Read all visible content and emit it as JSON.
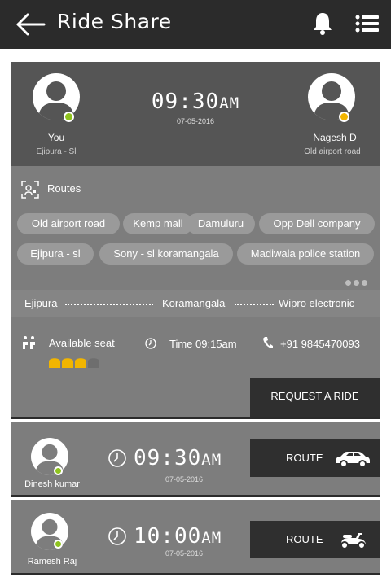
{
  "header": {
    "title": "Ride Share",
    "back_icon": "back-arrow-icon",
    "notification_icon": "bell-icon",
    "menu_icon": "list-menu-icon"
  },
  "ride_card": {
    "driver": {
      "name": "You",
      "location": "Ejipura - Sl",
      "status_color": "#8fc31f"
    },
    "passenger": {
      "name": "Nagesh D",
      "location": "Old airport road",
      "status_color": "#f2b500"
    },
    "time": "09:30",
    "ampm": "AM",
    "date": "07-05-2016",
    "routes_label": "Routes",
    "routes": [
      "Old airport road",
      "Kemp mall",
      "Damuluru",
      "Opp Dell company",
      "Ejipura - sl",
      "Sony - sl koramangala",
      "Madiwala police station"
    ],
    "path": [
      "Ejipura",
      "Koramangala",
      "Wipro electronic"
    ],
    "available_seat_label": "Available seat",
    "seats": {
      "total": 4,
      "available": 3
    },
    "time_label": "Time 09:15am",
    "phone": "+91 9845470093",
    "request_button": "REQUEST A RIDE"
  },
  "rides": [
    {
      "name": "Dinesh kumar",
      "time": "09:30",
      "ampm": "AM",
      "date": "07-05-2016",
      "button": "ROUTE",
      "vehicle_icon": "car-icon"
    },
    {
      "name": "Ramesh Raj",
      "time": "10:00",
      "ampm": "AM",
      "date": "07-05-2016",
      "button": "ROUTE",
      "vehicle_icon": "scooter-icon"
    }
  ],
  "colors": {
    "header_bg": "#2b2b2b",
    "card_bg": "#7d7d7d",
    "card_top_bg": "#555555",
    "button_bg": "#2f2f2f",
    "seat_available": "#f2b500",
    "seat_taken": "#6e6e6e",
    "online_dot": "#8fc31f"
  }
}
